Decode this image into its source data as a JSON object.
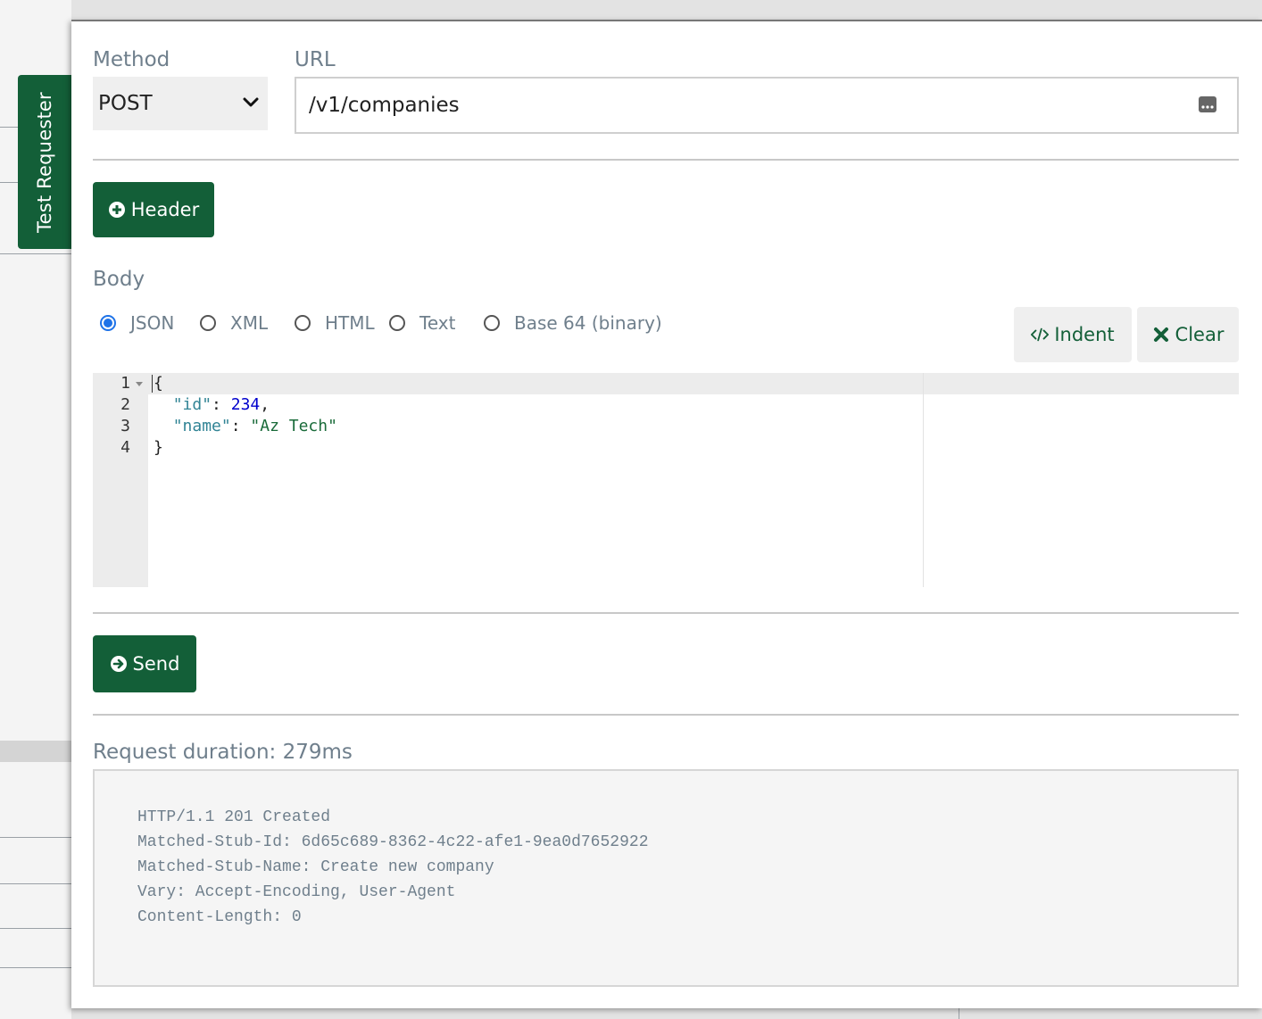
{
  "side_tab": {
    "label": "Test Requester"
  },
  "method": {
    "label": "Method",
    "value": "POST"
  },
  "url": {
    "label": "URL",
    "value": "/v1/companies"
  },
  "header_button": {
    "label": "Header",
    "icon": "plus-circle-icon"
  },
  "body": {
    "label": "Body",
    "formats": [
      {
        "label": "JSON",
        "checked": true
      },
      {
        "label": "XML",
        "checked": false
      },
      {
        "label": "HTML",
        "checked": false
      },
      {
        "label": "Text",
        "checked": false
      },
      {
        "label": "Base 64 (binary)",
        "checked": false
      }
    ],
    "indent_label": "Indent",
    "clear_label": "Clear"
  },
  "editor": {
    "line_numbers": [
      "1",
      "2",
      "3",
      "4"
    ],
    "lines": [
      [
        {
          "t": "{",
          "c": ""
        }
      ],
      [
        {
          "t": "  ",
          "c": ""
        },
        {
          "t": "\"id\"",
          "c": "tok-key"
        },
        {
          "t": ": ",
          "c": ""
        },
        {
          "t": "234",
          "c": "tok-num"
        },
        {
          "t": ",",
          "c": ""
        }
      ],
      [
        {
          "t": "  ",
          "c": ""
        },
        {
          "t": "\"name\"",
          "c": "tok-key"
        },
        {
          "t": ": ",
          "c": ""
        },
        {
          "t": "\"Az Tech\"",
          "c": "tok-str"
        }
      ],
      [
        {
          "t": "}",
          "c": ""
        }
      ]
    ]
  },
  "send_button": {
    "label": "Send",
    "icon": "arrow-right-circle-icon"
  },
  "response": {
    "duration_label": "Request duration: 279ms",
    "lines": [
      "HTTP/1.1 201 Created",
      "Matched-Stub-Id: 6d65c689-8362-4c22-afe1-9ea0d7652922",
      "Matched-Stub-Name: Create new company",
      "Vary: Accept-Encoding, User-Agent",
      "Content-Length: 0"
    ]
  },
  "colors": {
    "accent": "#135f38",
    "radio_checked": "#1f73e8",
    "label_text": "#6f7f8c"
  }
}
